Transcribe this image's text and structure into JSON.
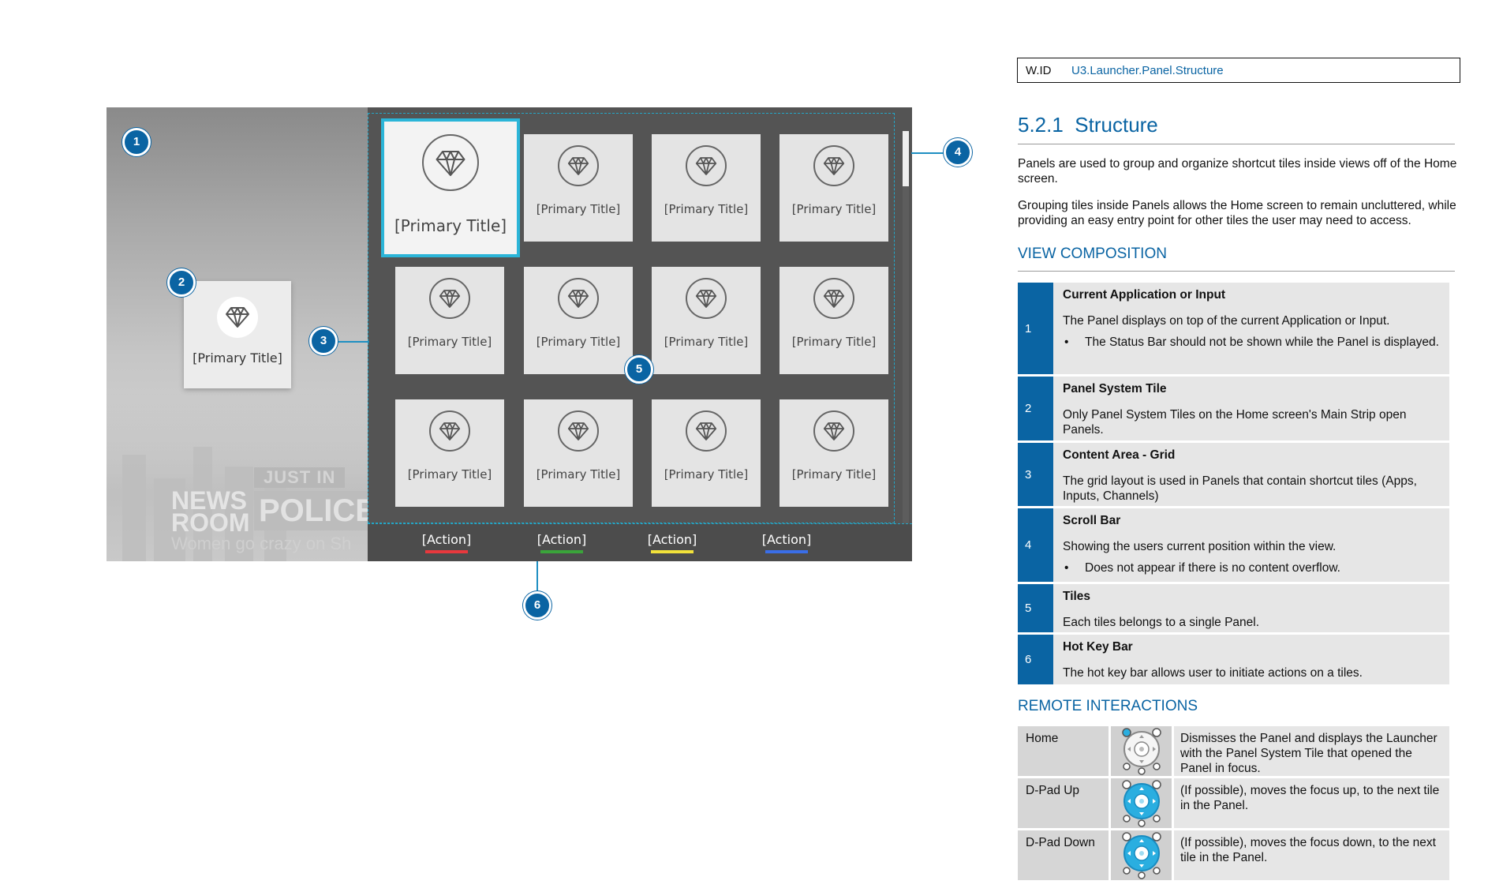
{
  "mockup": {
    "system_tile_title": "[Primary Title]",
    "tile_title": "[Primary Title]",
    "news": {
      "just_in": "JUST IN",
      "newsroom": "NEWS ROOM",
      "police": "POLICE",
      "ticker": "Women go crazy on Sh"
    },
    "hotkeys": [
      {
        "label": "[Action]",
        "color": "#e8383d"
      },
      {
        "label": "[Action]",
        "color": "#3aa43a"
      },
      {
        "label": "[Action]",
        "color": "#f2e23a"
      },
      {
        "label": "[Action]",
        "color": "#3a6ee8"
      }
    ],
    "callouts": [
      "1",
      "2",
      "3",
      "4",
      "5",
      "6"
    ],
    "accent_color": "#2bb5d8"
  },
  "doc": {
    "wid_label": "W.ID",
    "wid_value": "U3.Launcher.Panel.Structure",
    "section_number": "5.2.1",
    "section_title": "Structure",
    "para1": "Panels are used to group and organize shortcut tiles inside views off of the Home screen.",
    "para2": "Grouping tiles inside Panels allows the Home screen to remain uncluttered, while providing an easy entry point for other tiles the user may need to access.",
    "view_composition_heading": "VIEW COMPOSITION",
    "view_composition": [
      {
        "num": "1",
        "name": "Current Application or Input",
        "desc": "The Panel displays on top of the current Application or Input.",
        "bullet": "The Status Bar should not be shown while the Panel is displayed."
      },
      {
        "num": "2",
        "name": "Panel System Tile",
        "desc": "Only Panel System Tiles on the Home screen's Main Strip open Panels.",
        "bullet": ""
      },
      {
        "num": "3",
        "name": "Content Area - Grid",
        "desc": "The grid layout is used in Panels that contain shortcut tiles (Apps, Inputs, Channels)",
        "bullet": ""
      },
      {
        "num": "4",
        "name": "Scroll Bar",
        "desc": "Showing the users current position within the view.",
        "bullet": "Does not appear if there is no content overflow."
      },
      {
        "num": "5",
        "name": "Tiles",
        "desc": "Each tiles belongs to a single Panel.",
        "bullet": ""
      },
      {
        "num": "6",
        "name": "Hot Key Bar",
        "desc": "The hot key bar allows user to initiate actions on a tiles.",
        "bullet": ""
      }
    ],
    "remote_interactions_heading": "REMOTE INTERACTIONS",
    "remote_interactions": [
      {
        "key": "Home",
        "icon": "remote-home-icon",
        "desc": "Dismisses the Panel and displays the Launcher with the Panel System Tile that opened the Panel in focus."
      },
      {
        "key": "D-Pad Up",
        "icon": "remote-dpad-up-icon",
        "desc": "(If possible), moves the focus up, to the next tile in the Panel."
      },
      {
        "key": "D-Pad Down",
        "icon": "remote-dpad-down-icon",
        "desc": "(If possible), moves the focus down, to the next tile in the Panel."
      }
    ],
    "brand_color": "#0a64a3"
  }
}
